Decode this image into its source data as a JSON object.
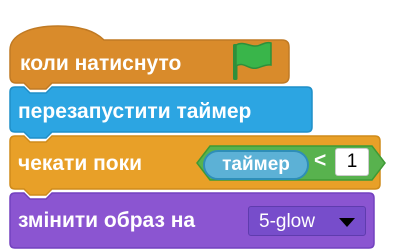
{
  "blocks": {
    "hat": {
      "label": "коли натиснуто",
      "icon": "green-flag-icon"
    },
    "reset_timer": {
      "label": "перезапустити таймер"
    },
    "wait_until": {
      "label": "чекати поки",
      "condition": {
        "reporter": "таймер",
        "operator": "<",
        "value": "1"
      }
    },
    "switch_costume": {
      "label": "змінити образ на",
      "selected": "5-glow"
    }
  },
  "colors": {
    "events": "#d98b2b",
    "sensing": "#2ca5e2",
    "control": "#e8a028",
    "operators": "#58b24e",
    "looks": "#8b55d1",
    "flag": "#39b54a"
  }
}
